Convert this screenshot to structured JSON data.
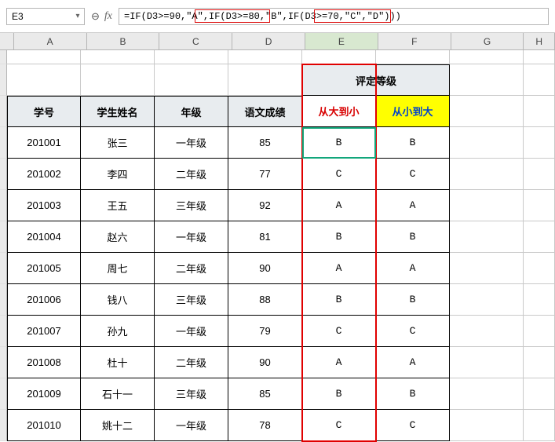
{
  "toolbar": {
    "name_box": "E3",
    "fx_label": "fx",
    "formula": "=IF(D3>=90,\"A\",IF(D3>=80,\"B\",IF(D3>=70,\"C\",\"D\")))"
  },
  "columns": [
    "A",
    "B",
    "C",
    "D",
    "E",
    "F",
    "G",
    "H"
  ],
  "merged_header": "评定等级",
  "headers": {
    "a": "学号",
    "b": "学生姓名",
    "c": "年级",
    "d": "语文成绩",
    "e": "从大到小",
    "f": "从小到大"
  },
  "rows": [
    {
      "id": "201001",
      "name": "张三",
      "grade": "一年级",
      "score": "85",
      "e": "B",
      "f": "B"
    },
    {
      "id": "201002",
      "name": "李四",
      "grade": "二年级",
      "score": "77",
      "e": "C",
      "f": "C"
    },
    {
      "id": "201003",
      "name": "王五",
      "grade": "三年级",
      "score": "92",
      "e": "A",
      "f": "A"
    },
    {
      "id": "201004",
      "name": "赵六",
      "grade": "一年级",
      "score": "81",
      "e": "B",
      "f": "B"
    },
    {
      "id": "201005",
      "name": "周七",
      "grade": "二年级",
      "score": "90",
      "e": "A",
      "f": "A"
    },
    {
      "id": "201006",
      "name": "钱八",
      "grade": "三年级",
      "score": "88",
      "e": "B",
      "f": "B"
    },
    {
      "id": "201007",
      "name": "孙九",
      "grade": "一年级",
      "score": "79",
      "e": "C",
      "f": "C"
    },
    {
      "id": "201008",
      "name": "杜十",
      "grade": "二年级",
      "score": "90",
      "e": "A",
      "f": "A"
    },
    {
      "id": "201009",
      "name": "石十一",
      "grade": "三年级",
      "score": "85",
      "e": "B",
      "f": "B"
    },
    {
      "id": "201010",
      "name": "姚十二",
      "grade": "一年级",
      "score": "78",
      "e": "C",
      "f": "C"
    }
  ],
  "icons": {
    "zoom_out": "⊖",
    "chevron_down": "▾"
  }
}
